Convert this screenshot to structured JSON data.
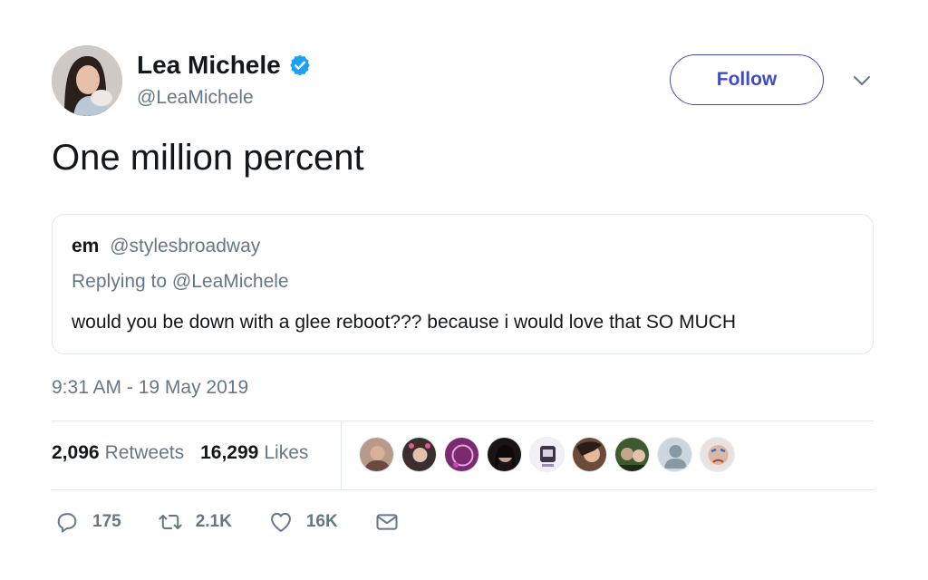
{
  "author": {
    "name": "Lea Michele",
    "handle": "@LeaMichele",
    "verified": true
  },
  "follow_button": {
    "label": "Follow"
  },
  "tweet": {
    "text": "One million percent",
    "timestamp": "9:31 AM - 19 May 2019"
  },
  "quoted_tweet": {
    "name": "em",
    "handle": "@stylesbroadway",
    "replying_to": "Replying to @LeaMichele",
    "text": "would you be down with a glee reboot??? because i would love that SO MUCH"
  },
  "stats": {
    "retweets_count": "2,096",
    "retweets_label": "Retweets",
    "likes_count": "16,299",
    "likes_label": "Likes"
  },
  "actions": {
    "replies": "175",
    "retweets": "2.1K",
    "likes": "16K"
  },
  "likers": [
    "liker-avatar-1",
    "liker-avatar-2",
    "liker-avatar-3",
    "liker-avatar-4",
    "liker-avatar-5",
    "liker-avatar-6",
    "liker-avatar-7",
    "liker-avatar-8",
    "liker-avatar-9"
  ],
  "colors": {
    "verified_blue": "#1da1f2",
    "follow_blue": "#3f4ac7",
    "muted_text": "#657786",
    "divider": "#e1e8ed"
  }
}
